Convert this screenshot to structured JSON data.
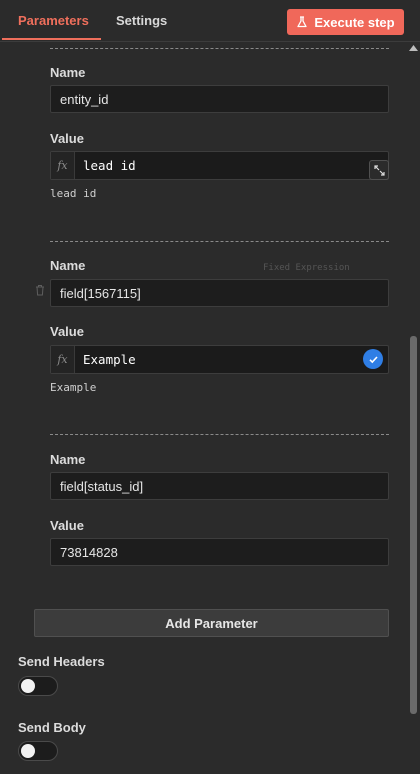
{
  "tabs": {
    "parameters": "Parameters",
    "settings": "Settings"
  },
  "execute_button": "Execute step",
  "parameters": [
    {
      "name_label": "Name",
      "name_value": "entity_id",
      "value_label": "Value",
      "value": "lead id",
      "is_expression": true,
      "result": "lead id"
    },
    {
      "name_label": "Name",
      "name_value": "field[1567115]",
      "value_label": "Value",
      "value": "Example",
      "is_expression": true,
      "result": "Example"
    },
    {
      "name_label": "Name",
      "name_value": "field[status_id]",
      "value_label": "Value",
      "value": "73814828",
      "is_expression": false
    }
  ],
  "add_parameter_button": "Add Parameter",
  "send_headers": {
    "label": "Send Headers",
    "enabled": false
  },
  "send_body": {
    "label": "Send Body",
    "enabled": false
  },
  "ghost_hint": "Fixed  Expression",
  "colors": {
    "accent": "#ef6f5c",
    "check": "#2f7ee5",
    "background": "#2b2b2b"
  }
}
